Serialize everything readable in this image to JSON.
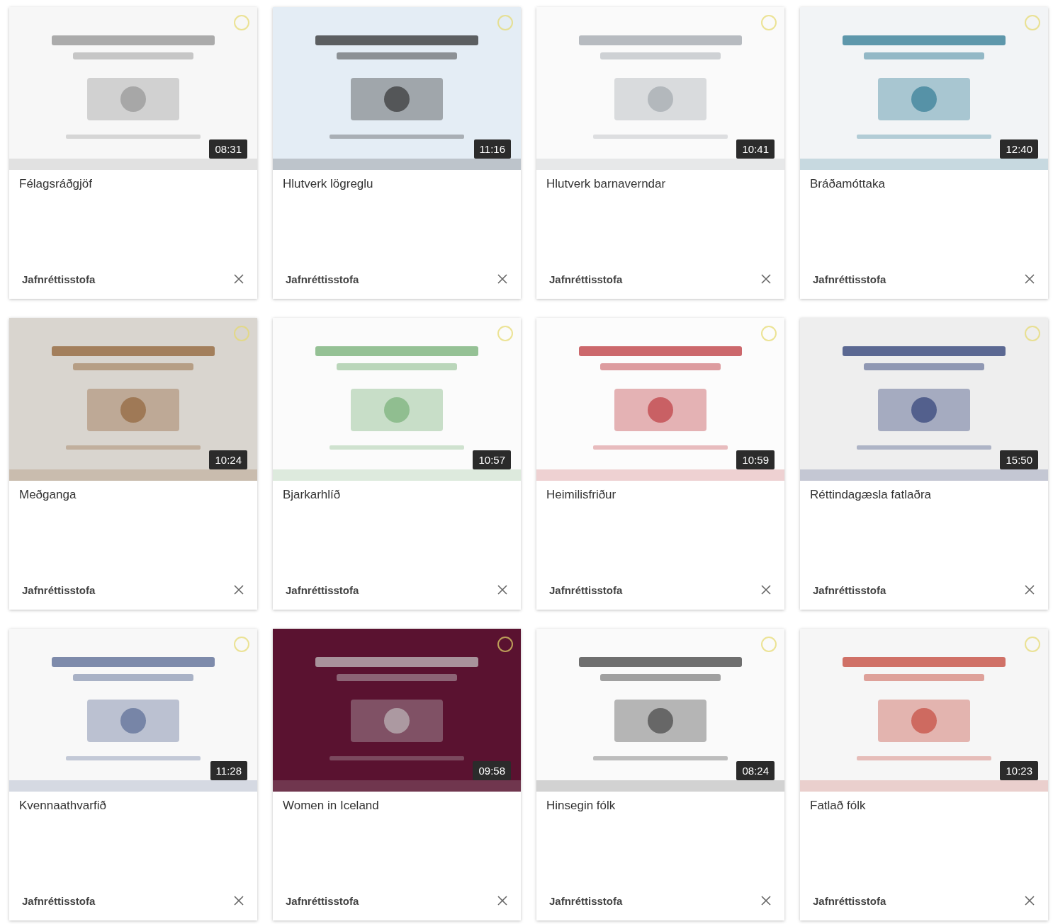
{
  "videos": [
    {
      "title": "Félagsráðgjöf",
      "duration": "08:31",
      "channel": "Jafnréttisstofa"
    },
    {
      "title": "Hlutverk lögreglu",
      "duration": "11:16",
      "channel": "Jafnréttisstofa"
    },
    {
      "title": "Hlutverk barnaverndar",
      "duration": "10:41",
      "channel": "Jafnréttisstofa"
    },
    {
      "title": "Bráðamóttaka",
      "duration": "12:40",
      "channel": "Jafnréttisstofa"
    },
    {
      "title": "Meðganga",
      "duration": "10:24",
      "channel": "Jafnréttisstofa"
    },
    {
      "title": "Bjarkarhlíð",
      "duration": "10:57",
      "channel": "Jafnréttisstofa"
    },
    {
      "title": "Heimilisfriður",
      "duration": "10:59",
      "channel": "Jafnréttisstofa"
    },
    {
      "title": "Réttindagæsla fatlaðra",
      "duration": "15:50",
      "channel": "Jafnréttisstofa"
    },
    {
      "title": "Kvennaathvarfið",
      "duration": "11:28",
      "channel": "Jafnréttisstofa"
    },
    {
      "title": "Women in Iceland",
      "duration": "09:58",
      "channel": "Jafnréttisstofa"
    },
    {
      "title": "Hinsegin fólk",
      "duration": "08:24",
      "channel": "Jafnréttisstofa"
    },
    {
      "title": "Fatlað fólk",
      "duration": "10:23",
      "channel": "Jafnréttisstofa"
    }
  ]
}
